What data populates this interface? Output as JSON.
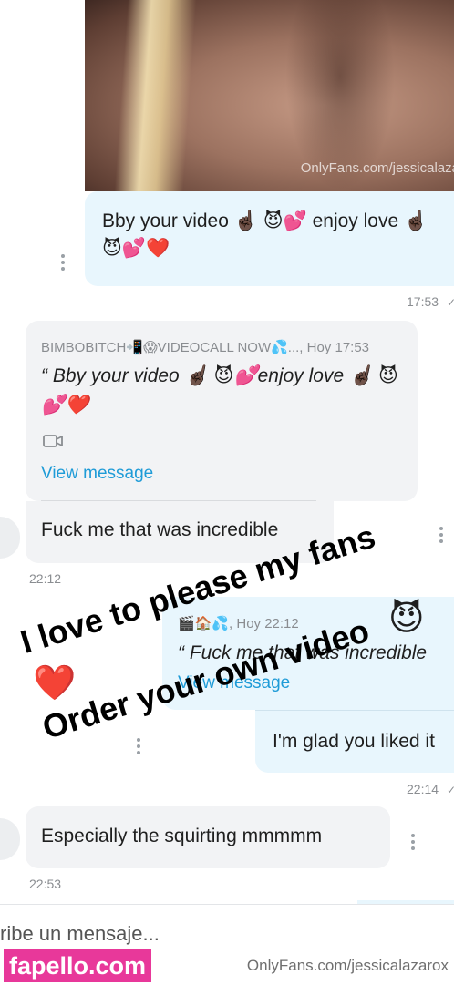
{
  "top_image": {
    "watermark": "OnlyFans.com/jessicalaza",
    "caption": "Bby your video ☝🏿 😈💕 enjoy love ☝🏿 😈💕❤️",
    "time": "17:53"
  },
  "quoted_reply_1": {
    "header": "BIMBOBITCH📲😱VIDEOCALL NOW💦..., Hoy 17:53",
    "text": "“ Bby your video ☝🏿 😈💕enjoy love ☝🏿 😈💕❤️",
    "view_link": "View message",
    "reply_text": "Fuck me that was incredible",
    "time": "22:12"
  },
  "quoted_reply_2": {
    "header": "🎬🏠💦, Hoy 22:12",
    "text": "“ Fuck me that was incredible",
    "view_link": "View message",
    "reply_text": "I'm glad you liked it",
    "time": "22:14"
  },
  "incoming_3": {
    "text": "Especially the squirting mmmmm",
    "time": "22:53"
  },
  "overlay": {
    "line1": "I love to please my fans",
    "line1_emoji": "😈",
    "heart": "❤️",
    "line2": "Order your own video"
  },
  "composer": {
    "placeholder": "ribe un mensaje..."
  },
  "watermarks": {
    "fapello": "fapello.com",
    "onlyfans": "OnlyFans.com/jessicalazarox"
  },
  "colors": {
    "outgoing_bubble": "#e8f6fd",
    "incoming_bubble": "#f2f3f5",
    "link": "#1e9bd7",
    "fapello_bg": "#e8389a"
  }
}
